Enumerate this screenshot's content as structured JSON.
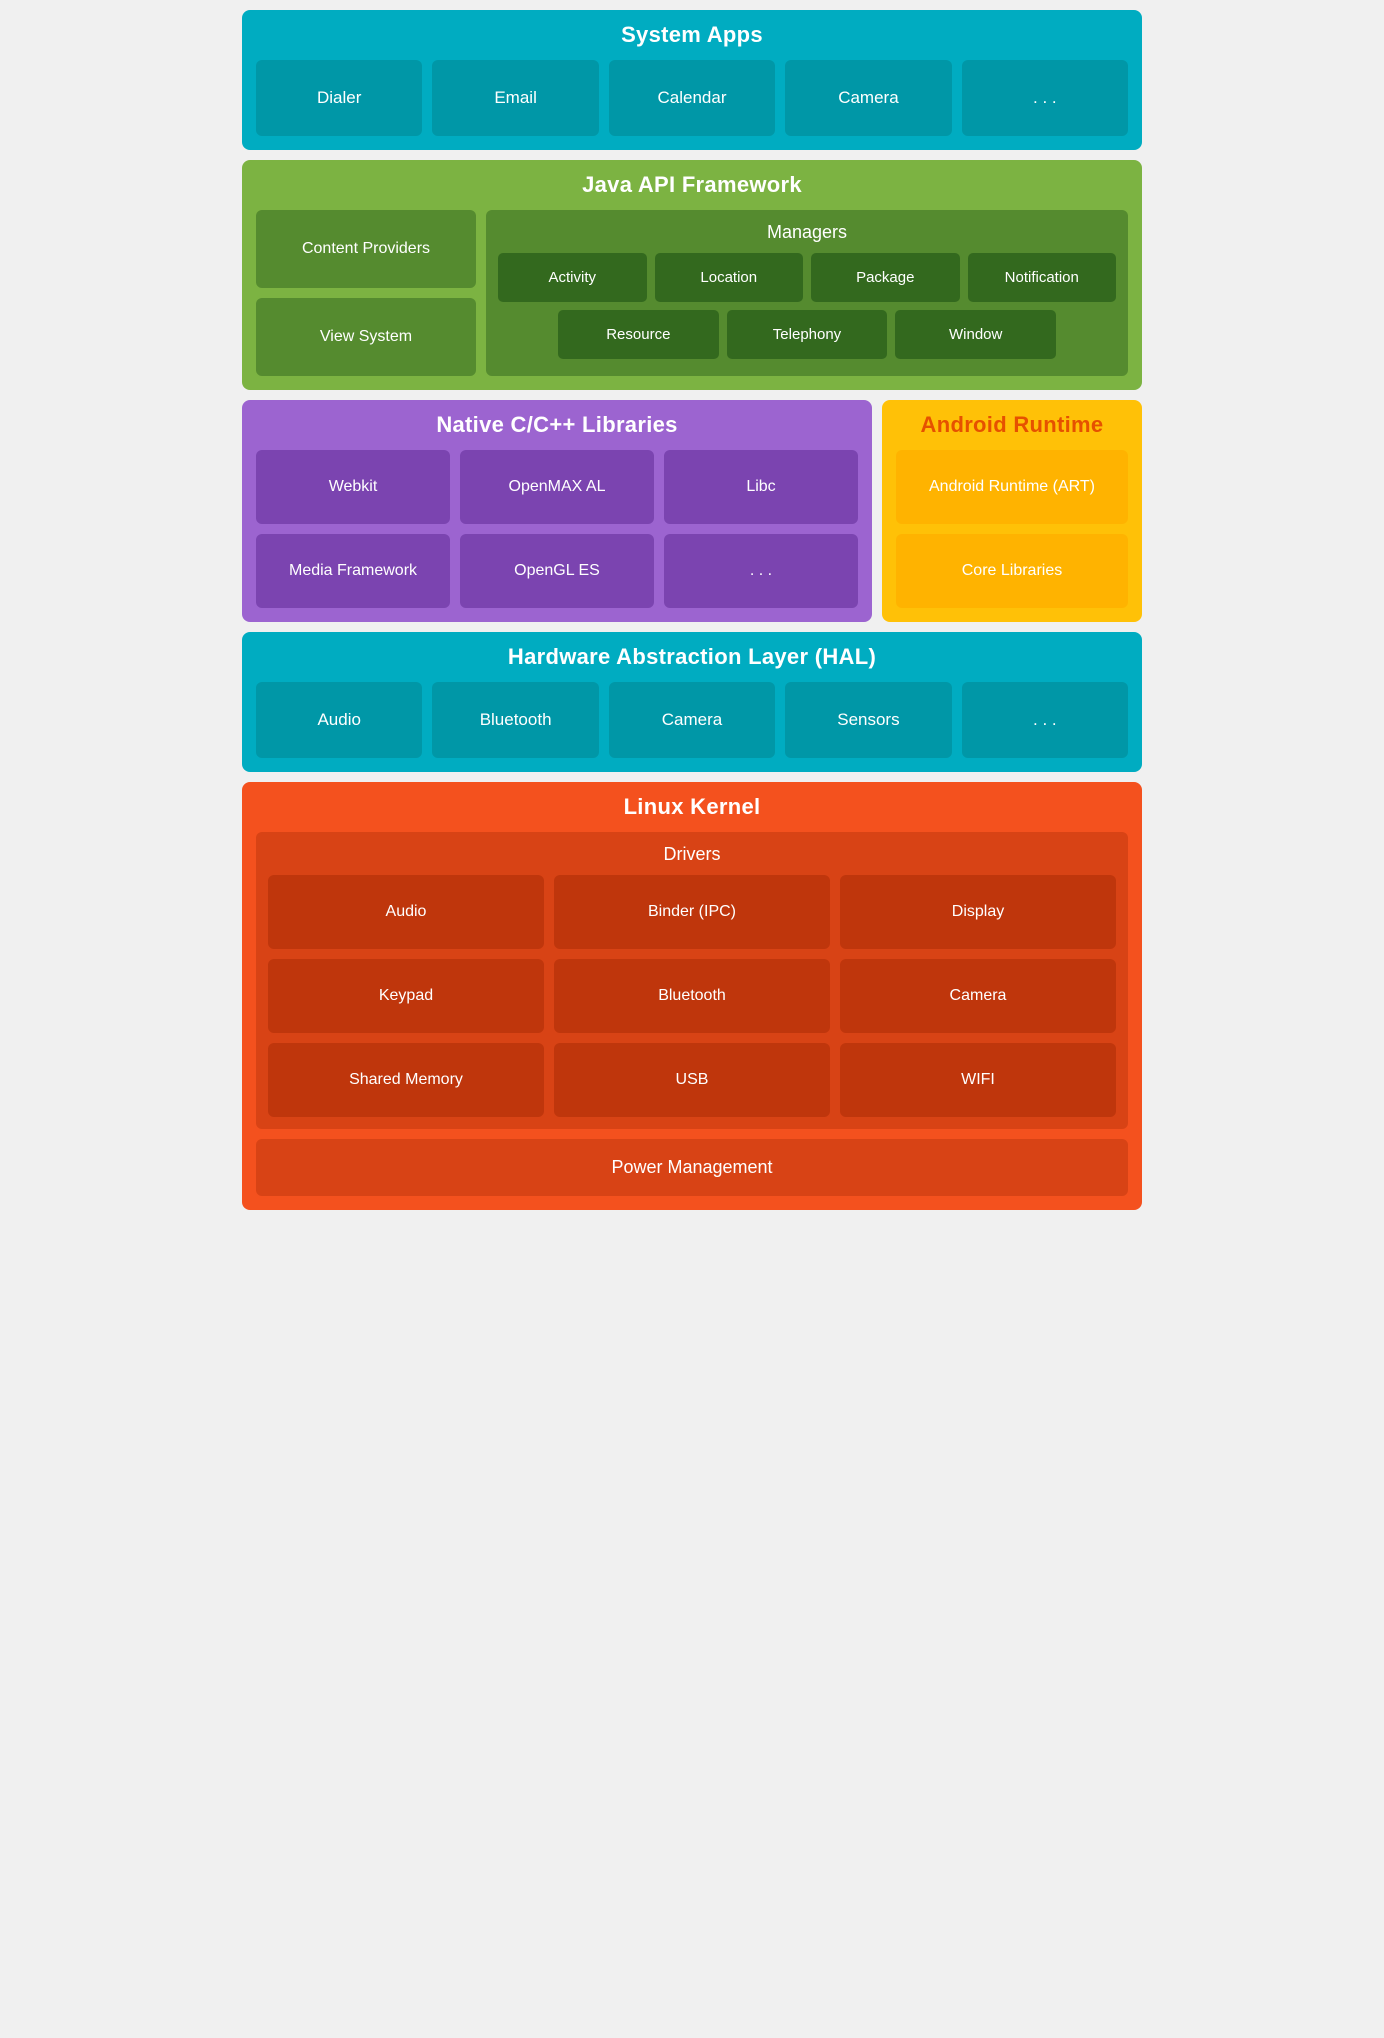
{
  "system_apps": {
    "title": "System Apps",
    "apps": [
      "Dialer",
      "Email",
      "Calendar",
      "Camera",
      ". . ."
    ]
  },
  "java_api": {
    "title": "Java API Framework",
    "left": [
      "Content Providers",
      "View System"
    ],
    "managers_title": "Managers",
    "managers_row1": [
      "Activity",
      "Location",
      "Package",
      "Notification"
    ],
    "managers_row2": [
      "Resource",
      "Telephony",
      "Window"
    ]
  },
  "native": {
    "title": "Native C/C++ Libraries",
    "items": [
      "Webkit",
      "OpenMAX AL",
      "Libc",
      "Media Framework",
      "OpenGL ES",
      ". . ."
    ]
  },
  "runtime": {
    "title": "Android Runtime",
    "items": [
      "Android Runtime (ART)",
      "Core Libraries"
    ]
  },
  "hal": {
    "title": "Hardware Abstraction Layer (HAL)",
    "items": [
      "Audio",
      "Bluetooth",
      "Camera",
      "Sensors",
      ". . ."
    ]
  },
  "linux_kernel": {
    "title": "Linux Kernel",
    "drivers_title": "Drivers",
    "drivers": [
      "Audio",
      "Binder (IPC)",
      "Display",
      "Keypad",
      "Bluetooth",
      "Camera",
      "Shared Memory",
      "USB",
      "WIFI"
    ],
    "power_mgmt": "Power Management"
  }
}
